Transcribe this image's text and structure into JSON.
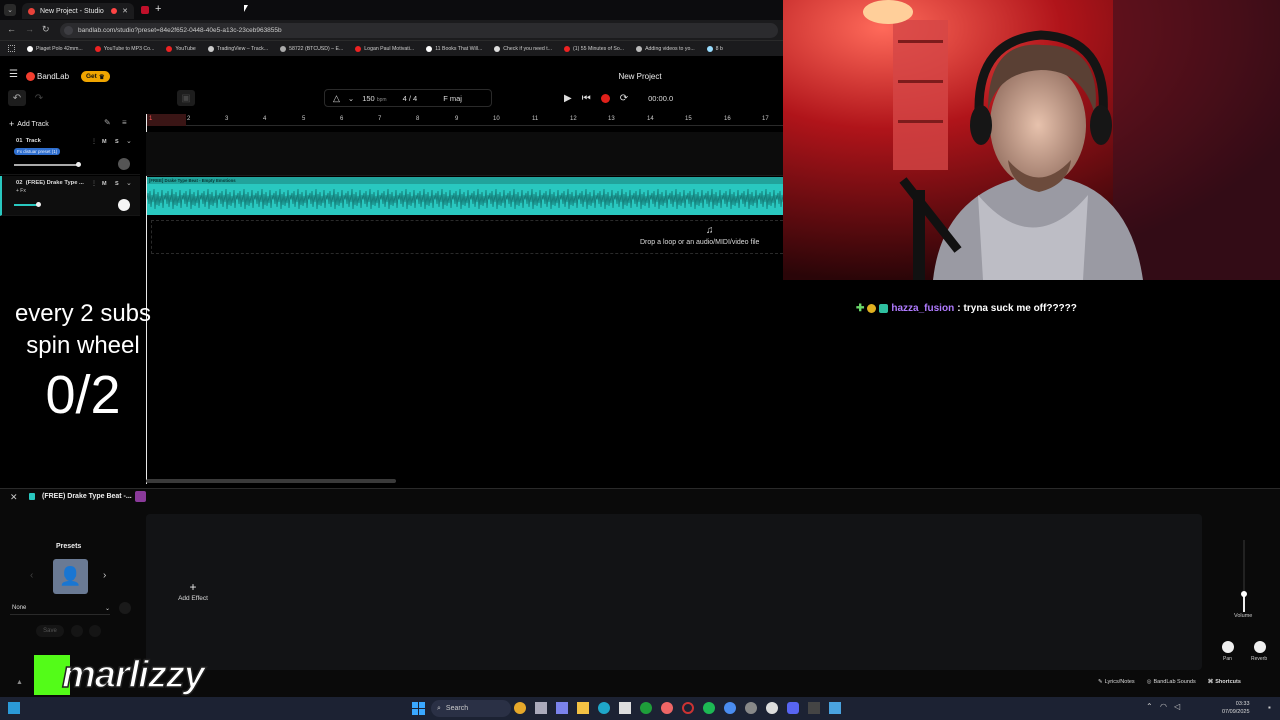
{
  "browser": {
    "tab_title": "New Project - Studio",
    "new_tab_symbol": "+",
    "url": "bandlab.com/studio?preset=84e2f652-0448-40e5-a13c-23ceb963855b",
    "bookmarks": [
      "Piaget Polo 42mm...",
      "YouTube to MP3 Co...",
      "YouTube",
      "TradingView – Track...",
      "58722 (BTCUSD) – E...",
      "Logan Paul Motivati...",
      "11 Books That Will...",
      "Check if you need t...",
      "(1) 55 Minutes of So...",
      "Adding videos to yo...",
      "8 b"
    ]
  },
  "bandlab": {
    "logo": "BandLab",
    "get_button": "Get",
    "project_title": "New Project",
    "tempo": "150",
    "tempo_unit": "bpm",
    "time_sig_num": "4",
    "time_sig_sep": "/",
    "time_sig_den": "4",
    "key": "F maj",
    "time": "00:00.0",
    "add_track": "Add Track",
    "ruler": [
      "1",
      "2",
      "3",
      "4",
      "5",
      "6",
      "7",
      "8",
      "9",
      "10",
      "11",
      "12",
      "13",
      "14",
      "15",
      "16",
      "17"
    ],
    "tracks": [
      {
        "num": "01",
        "name": "Track",
        "badge": "Fx distuar preset (1)",
        "m": "M",
        "s": "S"
      },
      {
        "num": "02",
        "name": "(FREE) Drake Type ...",
        "badge": "+ Fx",
        "m": "M",
        "s": "S"
      }
    ],
    "clip_label": "[FREE] Drake Type Beat - Empty Emotions",
    "drop_text": "Drop a loop or an audio/MIDI/video file",
    "selected_track": "(FREE) Drake Type Beat -...",
    "presets_label": "Presets",
    "preset_select": "None",
    "save_label": "Save",
    "add_effect": "Add Effect",
    "volume_label": "Volume",
    "pan_label": "Pan",
    "reverb_label": "Reverb",
    "footer": {
      "lyrics": "Lyrics/Notes",
      "sounds": "BandLab Sounds",
      "shortcuts": "Shortcuts"
    }
  },
  "overlay": {
    "line1": "every 2 subs",
    "line2": "spin wheel",
    "counter": "0/2",
    "streamer_tag": "marlizzy"
  },
  "chat": {
    "username": "hazza_fusion",
    "separator": ":",
    "message": "tryna suck me off?????"
  },
  "taskbar": {
    "search": "Search",
    "time": "03:33",
    "date": "07/09/2025"
  }
}
